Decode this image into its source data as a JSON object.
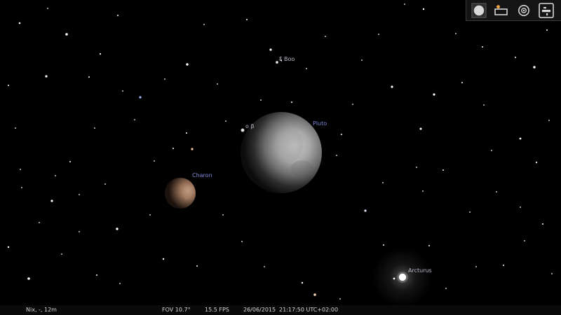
{
  "toolbar": {
    "buttons": [
      {
        "icon": "full-disk-icon"
      },
      {
        "icon": "ocular-icon"
      },
      {
        "icon": "target-icon"
      },
      {
        "icon": "telescope-icon"
      }
    ]
  },
  "labels": {
    "pluto": "Pluto",
    "charon": "Charon",
    "xi_boo": "ξ Boo",
    "o_boo": "o β",
    "arcturus": "Arcturus"
  },
  "status": {
    "location": "Nix, -, 12m",
    "fov": "FOV 10.7°",
    "fps": "15.5 FPS",
    "date": "26/06/2015",
    "time": "21:17:50 UTC+02:00"
  },
  "colors": {
    "sky": "#000000",
    "planet_label": "#7f86d9",
    "star_label": "#b8bcc8",
    "statusbar_text": "#d7d7d7"
  }
}
